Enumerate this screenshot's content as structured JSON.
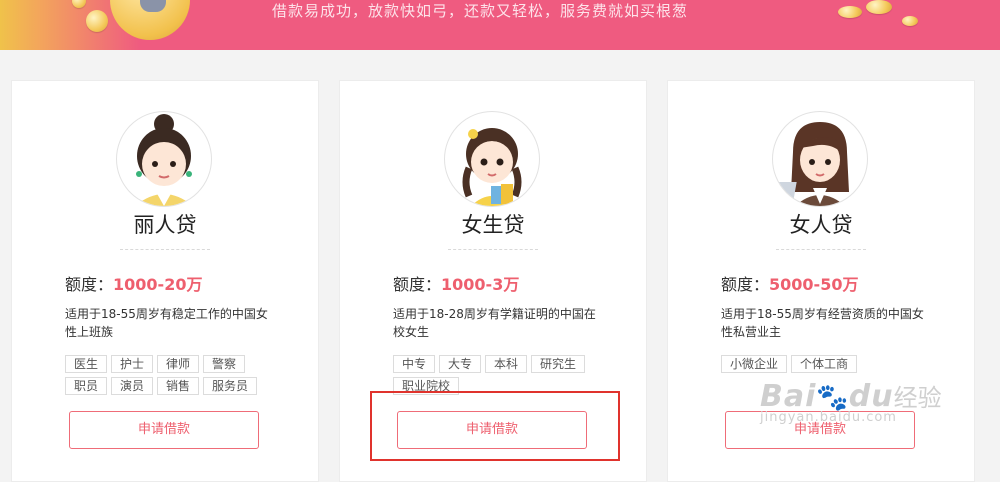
{
  "banner": {
    "tagline": "借款易成功，放款快如弓，还款又轻松，服务费就如买根葱"
  },
  "cards": [
    {
      "avatar_icon": "woman-bun-avatar-icon",
      "title": "丽人贷",
      "amount_label": "额度：",
      "amount_value": "1000-20万",
      "description": "适用于18-55周岁有稳定工作的中国女性上班族",
      "tags": [
        "医生",
        "护士",
        "律师",
        "警察",
        "职员",
        "演员",
        "销售",
        "服务员"
      ],
      "button_label": "申请借款"
    },
    {
      "avatar_icon": "girl-braids-avatar-icon",
      "title": "女生贷",
      "amount_label": "额度：",
      "amount_value": "1000-3万",
      "description": "适用于18-28周岁有学籍证明的中国在校女生",
      "tags": [
        "中专",
        "大专",
        "本科",
        "研究生",
        "职业院校"
      ],
      "button_label": "申请借款"
    },
    {
      "avatar_icon": "businesswoman-laptop-avatar-icon",
      "title": "女人贷",
      "amount_label": "额度：",
      "amount_value": "5000-50万",
      "description": "适用于18-55周岁有经营资质的中国女性私营业主",
      "tags": [
        "小微企业",
        "个体工商"
      ],
      "button_label": "申请借款"
    }
  ],
  "watermark": {
    "logo": "Bai",
    "logo_suffix": "du",
    "cn": "经验",
    "url": "jingyan.baidu.com"
  },
  "colors": {
    "banner_pink": "#ef5b80",
    "accent_red": "#ee5f6e",
    "highlight_red": "#e0332d"
  }
}
